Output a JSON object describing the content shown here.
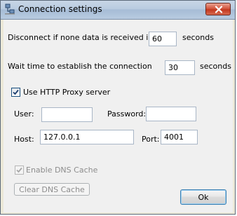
{
  "window": {
    "title": "Connection settings",
    "close_icon": "close-x-icon",
    "app_icon": "network-connection-icon"
  },
  "disconnect": {
    "label": "Disconnect if none data is received in",
    "value": "60",
    "unit": "seconds"
  },
  "wait": {
    "label": "Wait time to establish the connection",
    "value": "30",
    "unit": "seconds"
  },
  "proxy": {
    "checkbox_label": "Use HTTP Proxy server",
    "checked": true,
    "user_label": "User:",
    "user_value": "",
    "password_label": "Password:",
    "password_value": "",
    "host_label": "Host:",
    "host_value": "127.0.0.1",
    "port_label": "Port:",
    "port_value": "4001"
  },
  "dns": {
    "enable_label": "Enable DNS Cache",
    "enabled_checked": true,
    "disabled": true,
    "clear_label": "Clear DNS Cache"
  },
  "buttons": {
    "ok_label": "Ok"
  },
  "colors": {
    "title_gradient_top": "#c8d6e6",
    "close_red": "#c2381f",
    "dialog_bg": "#f0f0f0",
    "disabled_text": "#8d8d8d"
  }
}
